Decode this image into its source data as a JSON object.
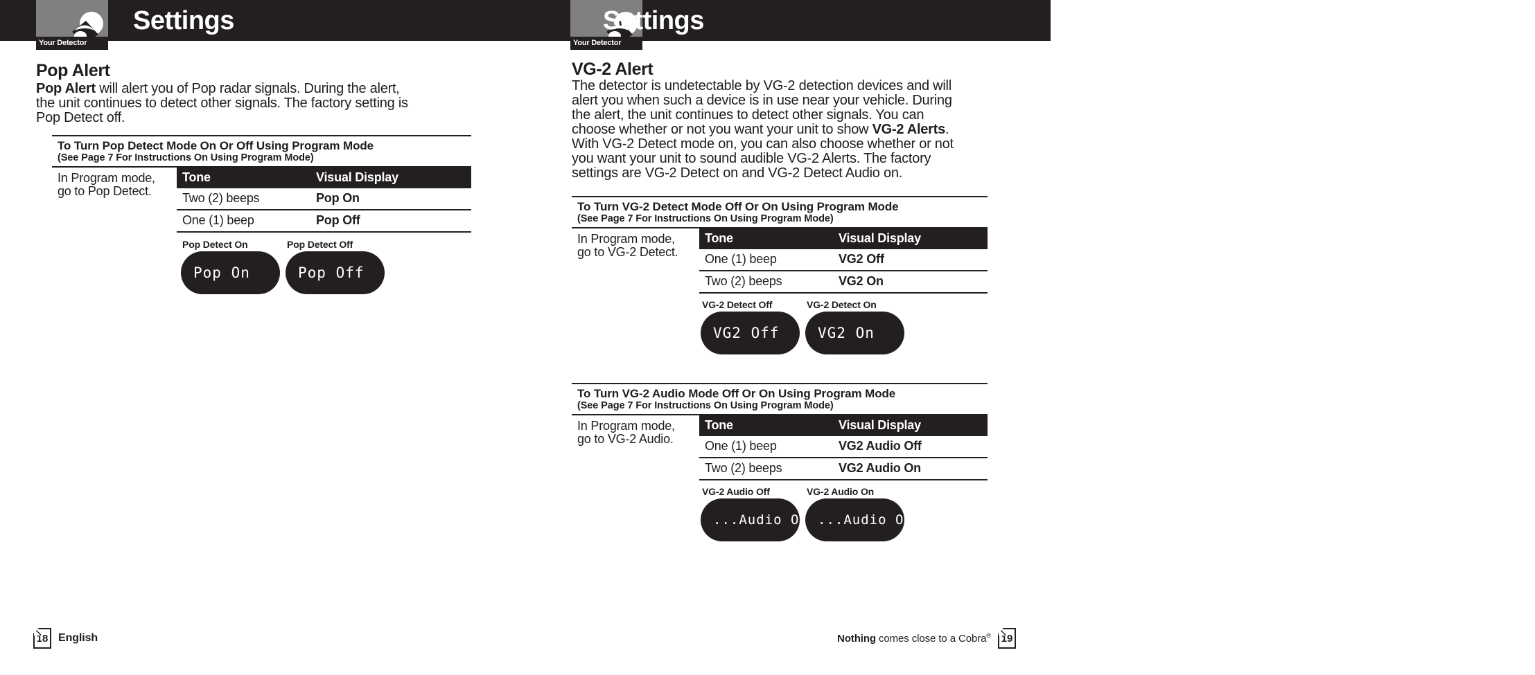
{
  "document": {
    "header_title": "Settings",
    "logo_badge": "Your Detector",
    "logo_icon": "radar-detector-icon"
  },
  "left_page": {
    "section_title": "Pop Alert",
    "body_lead": "Pop Alert",
    "body_rest": " will alert you of Pop radar signals. During the alert, the unit continues to detect other signals. The factory setting is Pop Detect off.",
    "spec": {
      "heading": "To Turn Pop Detect Mode On Or Off Using Program Mode",
      "subheading": "(See Page 7 For Instructions On Using Program Mode)",
      "note_line1": "In Program mode,",
      "note_line2": "go to Pop Detect.",
      "columns": [
        "Tone",
        "Visual Display"
      ],
      "rows": [
        {
          "tone": "Two (2) beeps",
          "display": "Pop On"
        },
        {
          "tone": "One (1) beep",
          "display": "Pop Off"
        }
      ],
      "displays": [
        {
          "caption": "Pop Detect On",
          "screen": "Pop On"
        },
        {
          "caption": "Pop Detect Off",
          "screen": "Pop Off"
        }
      ]
    }
  },
  "right_page": {
    "section_title": "VG-2 Alert",
    "body_part1": "The detector is undetectable by VG-2 detection devices and will alert you when such a device is in use near your vehicle. During the alert, the unit continues to detect other signals. You can choose whether or not you want your unit to show ",
    "body_bold": "VG-2 Alerts",
    "body_part2": ". With VG-2 Detect mode on, you can also choose whether or not you want your unit to sound audible VG-2 Alerts. The factory settings are VG-2 Detect on and VG-2 Detect Audio on.",
    "spec_detect": {
      "heading": "To Turn VG-2 Detect Mode Off Or On Using Program Mode",
      "subheading": "(See Page 7 For Instructions On Using Program Mode)",
      "note_line1": "In Program mode,",
      "note_line2": "go to VG-2 Detect.",
      "columns": [
        "Tone",
        "Visual Display"
      ],
      "rows": [
        {
          "tone": "One (1) beep",
          "display": "VG2 Off"
        },
        {
          "tone": "Two (2) beeps",
          "display": "VG2 On"
        }
      ],
      "displays": [
        {
          "caption": "VG-2 Detect Off",
          "screen": "VG2 Off"
        },
        {
          "caption": "VG-2 Detect On",
          "screen": "VG2 On"
        }
      ]
    },
    "spec_audio": {
      "heading": "To Turn VG-2 Audio Mode Off Or On Using Program Mode",
      "subheading": "(See Page 7 For Instructions On Using Program Mode)",
      "note_line1": "In Program mode,",
      "note_line2": "go to VG-2 Audio.",
      "columns": [
        "Tone",
        "Visual Display"
      ],
      "rows": [
        {
          "tone": "One (1) beep",
          "display": "VG2 Audio Off"
        },
        {
          "tone": "Two (2) beeps",
          "display": "VG2 Audio On"
        }
      ],
      "displays": [
        {
          "caption": "VG-2 Audio Off",
          "screen": "...Audio Off"
        },
        {
          "caption": "VG-2 Audio On",
          "screen": "...Audio On"
        }
      ]
    }
  },
  "footer": {
    "left_page_number": "18",
    "language": "English",
    "tagline_bold": "Nothing",
    "tagline_rest": " comes close to a Cobra",
    "tagline_mark": "®",
    "right_page_number": "19"
  },
  "colors": {
    "ink": "#231f20",
    "paper": "#ffffff",
    "logo_gray": "#808080"
  }
}
